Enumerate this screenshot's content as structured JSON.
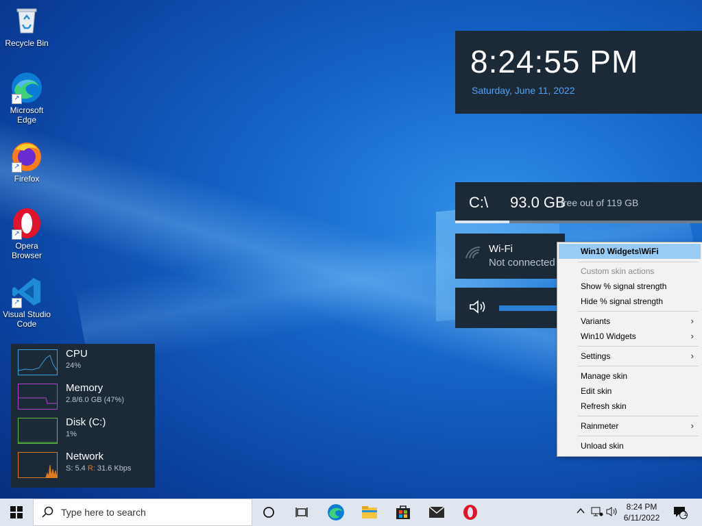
{
  "desktop_icons": [
    {
      "label_line1": "Recycle Bin",
      "label_line2": "",
      "icon": "recycle-bin-icon"
    },
    {
      "label_line1": "Microsoft",
      "label_line2": "Edge",
      "icon": "edge-icon"
    },
    {
      "label_line1": "Firefox",
      "label_line2": "",
      "icon": "firefox-icon"
    },
    {
      "label_line1": "Opera",
      "label_line2": "Browser",
      "icon": "opera-icon"
    },
    {
      "label_line1": "Visual Studio",
      "label_line2": "Code",
      "icon": "vscode-icon"
    }
  ],
  "clock_widget": {
    "time": "8:24:55 PM",
    "date": "Saturday, June 11, 2022",
    "date_color": "#4ea3ff"
  },
  "disk_widget": {
    "drive": "C:\\",
    "free": "93.0 GB",
    "sub": "free out of 119 GB",
    "used_fraction": 0.22
  },
  "wifi_widget": {
    "name": "Wi-Fi",
    "status": "Not connected"
  },
  "volume_widget": {
    "level_fraction": 1.0
  },
  "context_menu": {
    "title": "Win10 Widgets\\WiFi",
    "custom_actions_label": "Custom skin actions",
    "show_signal": "Show % signal strength",
    "hide_signal": "Hide % signal strength",
    "variants": "Variants",
    "win10_widgets": "Win10 Widgets",
    "settings": "Settings",
    "manage_skin": "Manage skin",
    "edit_skin": "Edit skin",
    "refresh_skin": "Refresh skin",
    "rainmeter": "Rainmeter",
    "unload_skin": "Unload skin",
    "submenu_arrow": "›",
    "highlight_color": "#99ccf4"
  },
  "performance_widget": {
    "cpu": {
      "label": "CPU",
      "value": "24%",
      "color": "#3aa0e0"
    },
    "memory": {
      "label": "Memory",
      "value": "2.8/6.0 GB (47%)",
      "color": "#b040d0"
    },
    "disk": {
      "label": "Disk (C:)",
      "value": "1%",
      "color": "#5cc040"
    },
    "network": {
      "label": "Network",
      "send_label": "S:",
      "send_value": "5.4",
      "recv_label": "R:",
      "recv_value": "31.6 Kbps",
      "recv_color": "#e07a20",
      "color": "#e07a20"
    }
  },
  "taskbar": {
    "search_placeholder": "Type here to search",
    "time": "8:24 PM",
    "date": "6/11/2022",
    "notification_count": "1",
    "apps": [
      "cortana-icon",
      "task-view-icon",
      "edge-icon",
      "file-explorer-icon",
      "store-icon",
      "mail-icon",
      "opera-icon"
    ]
  }
}
